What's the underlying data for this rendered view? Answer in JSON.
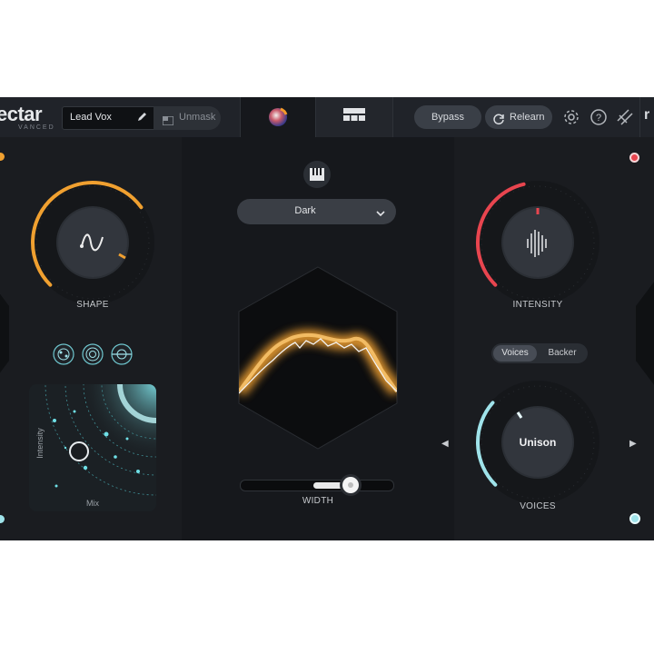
{
  "header": {
    "logo_text": "ectar",
    "logo_sub": "VANCED",
    "preset_name": "Lead Vox",
    "unmask_label": "Unmask",
    "bypass_label": "Bypass",
    "relearn_label": "Relearn",
    "partial_edge_text": "r"
  },
  "colors": {
    "accent_orange": "#f0a030",
    "accent_red": "#e8454f",
    "accent_cyan": "#9fe3ea"
  },
  "icons": [
    "pencil-icon",
    "unmask-icon",
    "sphere-icon",
    "grid-icon",
    "refresh-icon",
    "gear-icon",
    "help-icon",
    "route-icon",
    "piano-icon",
    "chevron-down-icon",
    "arrow-left-icon",
    "arrow-right-icon"
  ],
  "shape": {
    "label": "SHAPE",
    "level": 0.7
  },
  "intensity": {
    "label": "INTENSITY",
    "level": 0.45
  },
  "style_dropdown": {
    "selected": "Dark"
  },
  "width": {
    "label": "WIDTH",
    "level": 0.72
  },
  "voices": {
    "tabs": [
      "Voices",
      "Backer"
    ],
    "active_tab": "Voices",
    "mode": "Unison",
    "label": "VOICES",
    "level": 0.32
  },
  "mix_pad": {
    "y_label": "Intensity",
    "x_label": "Mix"
  }
}
